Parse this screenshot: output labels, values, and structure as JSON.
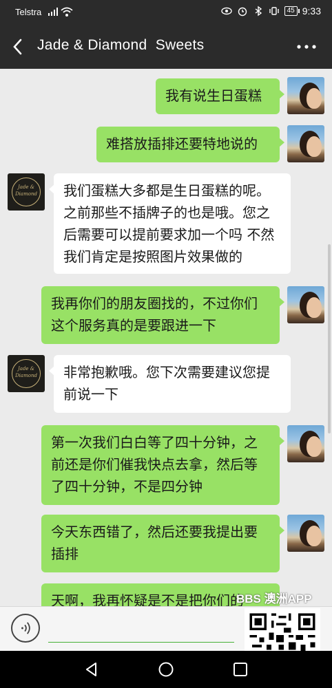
{
  "status_bar": {
    "carrier": "Telstra",
    "battery": "45",
    "time": "9:33"
  },
  "nav": {
    "title": "Jade & Diamond  Sweets"
  },
  "shop_logo_text": "Jade & Diamond",
  "messages": [
    {
      "from": "me",
      "text": "我有说生日蛋糕"
    },
    {
      "from": "me",
      "text": "难搭放插排还要特地说的"
    },
    {
      "from": "them",
      "lines": [
        "我们蛋糕大多都是生日蛋糕的呢。",
        "之前那些不插牌子的也是哦。您之",
        "后需要可以提前要求加一个吗 不然",
        "我们肯定是按照图片效果做的"
      ]
    },
    {
      "from": "me",
      "lines": [
        "我再你们的朋友圈找的，不过你们",
        "这个服务真的是要跟进一下"
      ]
    },
    {
      "from": "them",
      "lines": [
        "非常抱歉哦。您下次需要建议您提",
        "前说一下"
      ]
    },
    {
      "from": "me",
      "lines": [
        "第一次我们白白等了四十分钟，之",
        "前还是你们催我快点去拿，然后等",
        "了四十分钟，不是四分钟"
      ]
    },
    {
      "from": "me",
      "lines": [
        "今天东西错了，然后还要我提出要",
        "插排"
      ]
    },
    {
      "from": "me",
      "lines": [
        "天啊，我再怀疑是不是把你们的"
      ]
    }
  ],
  "input": {
    "value": ""
  },
  "watermark": {
    "text": "BBS 澳洲APP"
  }
}
